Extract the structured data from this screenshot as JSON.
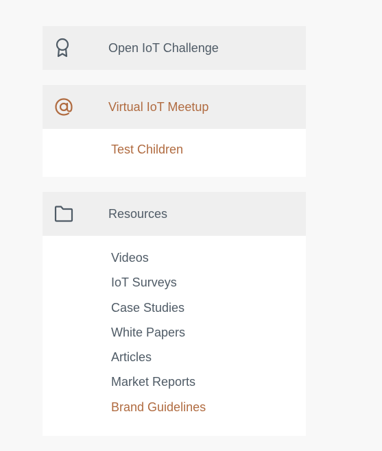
{
  "nav": {
    "sections": [
      {
        "label": "Open IoT Challenge",
        "icon": "award-icon",
        "active": false
      },
      {
        "label": "Virtual IoT Meetup",
        "icon": "at-icon",
        "active": true,
        "children": [
          {
            "label": "Test Children",
            "active": true
          }
        ]
      },
      {
        "label": "Resources",
        "icon": "folder-icon",
        "active": false,
        "children": [
          {
            "label": "Videos",
            "active": false
          },
          {
            "label": "IoT Surveys",
            "active": false
          },
          {
            "label": "Case Studies",
            "active": false
          },
          {
            "label": "White Papers",
            "active": false
          },
          {
            "label": "Articles",
            "active": false
          },
          {
            "label": "Market Reports",
            "active": false
          },
          {
            "label": "Brand Guidelines",
            "active": true
          }
        ]
      }
    ]
  },
  "colors": {
    "background": "#f8f8f8",
    "header_background": "#efefef",
    "text": "#4f5b66",
    "accent": "#b06b40"
  }
}
